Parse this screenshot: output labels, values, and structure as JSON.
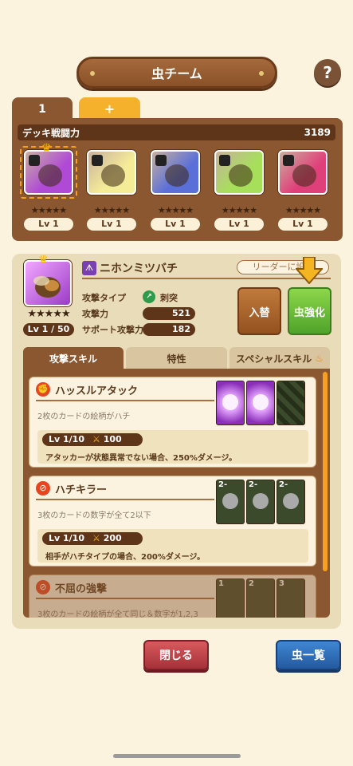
{
  "header": {
    "title": "虫チーム",
    "help": "?"
  },
  "deck_tabs": [
    {
      "label": "1"
    },
    {
      "label": "+"
    }
  ],
  "deck": {
    "power_label": "デッキ戦闘力",
    "power_value": "3189",
    "members": [
      {
        "level": "Lv 1",
        "stars": "★★★★★",
        "color": "#b04ad6"
      },
      {
        "level": "Lv 1",
        "stars": "★★★★★",
        "color": "#f5ec98"
      },
      {
        "level": "Lv 1",
        "stars": "★★★★★",
        "color": "#5a6fd8"
      },
      {
        "level": "Lv 1",
        "stars": "★★★★★",
        "color": "#a6e05a"
      },
      {
        "level": "Lv 1",
        "stars": "★★★★★",
        "color": "#e0407a"
      }
    ]
  },
  "bug": {
    "name": "ニホンミツバチ",
    "leader_button": "リーダーに設定",
    "stars": "★★★★★",
    "level": "Lv 1 / 50",
    "stats": [
      {
        "label": "攻撃タイプ",
        "value": "刺突"
      },
      {
        "label": "攻撃力",
        "value": "521"
      },
      {
        "label": "サポート攻撃力",
        "value": "182"
      }
    ],
    "swap_button": "入替",
    "upgrade_button": "虫強化"
  },
  "skill_tabs": [
    "攻撃スキル",
    "特性",
    "スペシャルスキル"
  ],
  "skills": [
    {
      "name": "ハッスルアタック",
      "condition": "2枚のカードの絵柄がハチ",
      "level": "Lv 1/10",
      "power": "100",
      "effect": "アタッカーが状態異常でない場合、250%ダメージ。",
      "card_labels": [
        "",
        "",
        ""
      ]
    },
    {
      "name": "ハチキラー",
      "condition": "3枚のカードの数字が全て2以下",
      "level": "Lv 1/10",
      "power": "200",
      "effect": "相手がハチタイプの場合、200%ダメージ。",
      "card_labels": [
        "2-",
        "2-",
        "2-"
      ]
    },
    {
      "name": "不屈の強撃",
      "condition": "3枚のカードの絵柄が全て同じ＆数字が1,2,3",
      "card_labels": [
        "1",
        "2",
        "3"
      ]
    }
  ],
  "footer": {
    "close": "閉じる",
    "list": "虫一覧"
  }
}
